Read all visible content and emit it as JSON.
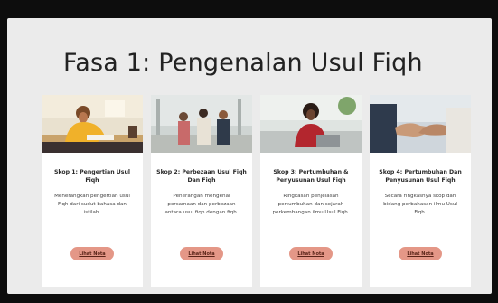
{
  "page": {
    "title": "Fasa 1: Pengenalan Usul Fiqh"
  },
  "cards": [
    {
      "title": "Skop 1: Pengertian Usul Fiqh",
      "description": "Menerangkan pengertian usul Fiqh dari sudut bahasa dan istilah.",
      "button_label": "Lihat Nota",
      "photo_icon": "student-writing-photo"
    },
    {
      "title": "Skop 2: Perbezaan Usul Fiqh Dan Fiqh",
      "description": "Penerangan mengenai persamaan dan perbezaan antara usul fiqh dengan fiqh.",
      "button_label": "Lihat Nota",
      "photo_icon": "students-walking-photo"
    },
    {
      "title": "Skop 3: Pertumbuhan & Penyusunan Usul Fiqh",
      "description": "Ringkasan penjelasan pertumbuhan dan sejarah perkembangan ilmu Usul Fiqh.",
      "button_label": "Lihat Nota",
      "photo_icon": "woman-laptop-photo"
    },
    {
      "title": "Skop 4: Pertumbuhan Dan Penyusunan Usul Fiqh",
      "description": "Secara ringkasnya skop dan bidang perbahasan ilmu Usul Fiqh.",
      "button_label": "Lihat Nota",
      "photo_icon": "handshake-photo"
    }
  ],
  "colors": {
    "frame": "#0d0d0d",
    "background": "#ebebeb",
    "card": "#ffffff",
    "button": "#e49787",
    "button_text": "#5a2418"
  }
}
